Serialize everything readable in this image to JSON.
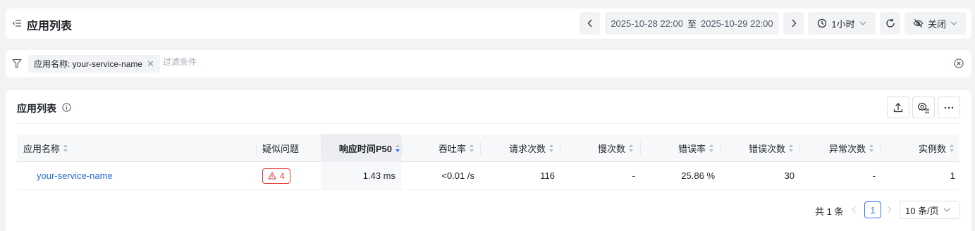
{
  "header": {
    "title": "应用列表",
    "date_start": "2025-10-28 22:00",
    "date_sep": "至",
    "date_end": "2025-10-29 22:00",
    "interval": "1小时",
    "auto_refresh": "关闭",
    "icons": [
      "menu-fold-icon",
      "chevron-left-icon",
      "chevron-right-icon",
      "clock-icon",
      "chevron-down-icon",
      "refresh-icon",
      "eye-off-icon"
    ]
  },
  "filter": {
    "tag": "应用名称: your-service-name",
    "placeholder": "过滤条件"
  },
  "main": {
    "section_title": "应用列表",
    "columns": [
      "应用名称",
      "疑似问题",
      "响应时间P50",
      "吞吐率",
      "请求次数",
      "慢次数",
      "错误率",
      "错误次数",
      "异常次数",
      "实例数"
    ],
    "sorted_column": "响应时间P50",
    "rows": [
      {
        "name": "your-service-name",
        "issues": "4",
        "p50": "1.43 ms",
        "throughput": "<0.01 /s",
        "requests": "116",
        "slow": "-",
        "error_rate": "25.86 %",
        "errors": "30",
        "exceptions": "-",
        "instances": "1"
      }
    ]
  },
  "pagination": {
    "total": "共 1 条",
    "current_page": "1",
    "page_size": "10 条/页"
  },
  "colors": {
    "accent": "#3370ff",
    "link": "#2c6ed4",
    "danger": "#e23a3a",
    "background": "#f2f3f5"
  }
}
